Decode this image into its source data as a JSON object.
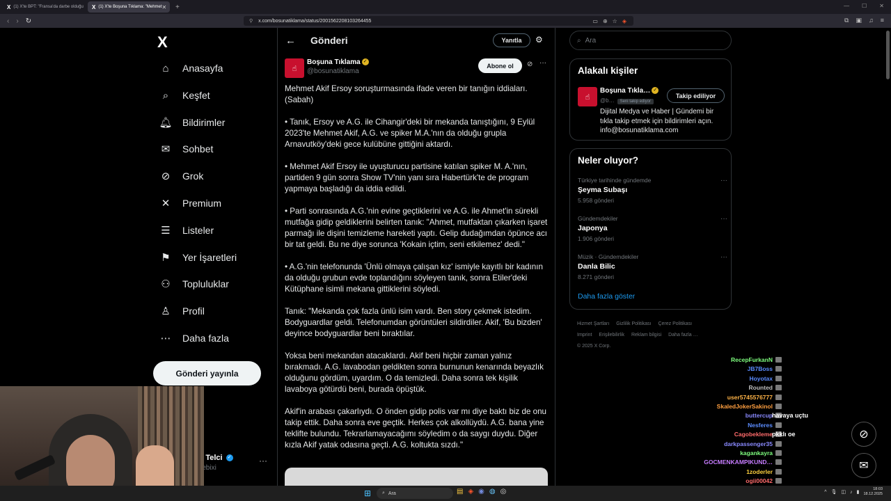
{
  "browser": {
    "tabs": [
      {
        "label": "(1) X'te BPT: \"Fransa'da darbe olduğu"
      },
      {
        "label": "(1) X'te Boşuna Tıklama: \"Mehmet"
      }
    ],
    "url": "x.com/bosunatiklama/status/2001562208103264455"
  },
  "nav": {
    "logo": "X",
    "items": [
      {
        "label": "Anasayfa",
        "icon": "home-icon",
        "glyph": "⌂"
      },
      {
        "label": "Keşfet",
        "icon": "search-icon",
        "glyph": "⌕"
      },
      {
        "label": "Bildirimler",
        "icon": "bell-icon",
        "glyph": "🔔︎",
        "badge": "1"
      },
      {
        "label": "Sohbet",
        "icon": "mail-icon",
        "glyph": "✉"
      },
      {
        "label": "Grok",
        "icon": "grok-icon",
        "glyph": "⊘"
      },
      {
        "label": "Premium",
        "icon": "x-premium-icon",
        "glyph": "✕"
      },
      {
        "label": "Listeler",
        "icon": "list-icon",
        "glyph": "☰"
      },
      {
        "label": "Yer İşaretleri",
        "icon": "bookmark-icon",
        "glyph": "⚑"
      },
      {
        "label": "Topluluklar",
        "icon": "communities-icon",
        "glyph": "⚇"
      },
      {
        "label": "Profil",
        "icon": "profile-icon",
        "glyph": "♙"
      },
      {
        "label": "Daha fazla",
        "icon": "more-circle-icon",
        "glyph": "⋯"
      }
    ],
    "post_button": "Gönderi yayınla",
    "profile_name": "r Telci",
    "profile_handle": "lebixi"
  },
  "post": {
    "header_title": "Gönderi",
    "reply_button": "Yanıtla",
    "author_name": "Boşuna Tıklama",
    "author_handle": "@bosunatiklama",
    "follow_button": "Abone ol",
    "paragraphs": [
      "Mehmet Akif Ersoy soruşturmasında ifade veren bir tanığın iddiaları. (Sabah)",
      "• Tanık, Ersoy ve A.G. ile Cihangir'deki bir mekanda tanıştığını, 9 Eylül 2023'te Mehmet Akif, A.G. ve spiker M.A.'nın da olduğu grupla Arnavutköy'deki gece kulübüne gittiğini aktardı.",
      "• Mehmet Akif Ersoy ile uyuşturucu partisine katılan spiker M. A.'nın, partiden 9 gün sonra Show TV'nin yanı sıra Habertürk'te de program yapmaya başladığı da iddia edildi.",
      "• Parti sonrasında A.G.'nin evine geçtiklerini ve A.G. ile Ahmet'in sürekli mutfağa gidip geldiklerini belirten tanık: \"Ahmet, mutfaktan çıkarken işaret parmağı ile dişini temizleme hareketi yaptı. Gelip dudağımdan öpünce acı bir tat geldi. Bu ne diye sorunca 'Kokain içtim, seni etkilemez' dedi.\"",
      "• A.G.'nin telefonunda 'Ünlü olmaya çalışan kız' ismiyle kayıtlı bir kadının da olduğu grubun evde toplandığını söyleyen tanık, sonra Etiler'deki Kütüphane isimli mekana gittiklerini söyledi.",
      "Tanık: \"Mekanda çok fazla ünlü isim vardı. Ben story çekmek istedim. Bodyguardlar geldi. Telefonumdan görüntüleri sildirdiler. Akif, 'Bu bizden' deyince bodyguardlar beni bıraktılar.",
      "Yoksa beni mekandan atacaklardı. Akif beni hiçbir zaman yalnız bırakmadı. A.G. lavabodan geldikten sonra burnunun kenarında beyazlık olduğunu gördüm, uyardım. O da temizledi. Daha sonra tek kişilik lavaboya götürdü beni, burada öpüştük.",
      "Akif'in arabası çakarlıydı. O önden gidip polis var mı diye baktı biz de onu takip ettik. Daha sonra eve geçtik. Herkes çok alkollüydü. A.G. bana yine teklifte bulundu. Tekrarlamayacağımı söyledim o da saygı duydu. Diğer kızla Akif yatak odasına geçti. A.G. koltukta sızdı.\""
    ]
  },
  "sidebar": {
    "search_placeholder": "Ara",
    "related_title": "Alakalı kişiler",
    "related": {
      "name": "Boşuna Tıkla…",
      "handle": "@b…",
      "sub_label": "Seni takip ediyor",
      "button": "Takip ediliyor",
      "bio": "Dijital Medya ve Haber | Gündemi bir tıkla takip etmek için bildirimleri açın. info@bosunatiklama.com"
    },
    "trends_title": "Neler oluyor?",
    "trends": [
      {
        "category": "Türkiye tarihinde gündemde",
        "name": "Şeyma Subaşı",
        "count": "5.958 gönderi"
      },
      {
        "category": "Gündemdekiler",
        "name": "Japonya",
        "count": "1.906 gönderi"
      },
      {
        "category": "Müzik · Gündemdekiler",
        "name": "Danla Bilic",
        "count": "8.271 gönderi"
      }
    ],
    "show_more": "Daha fazla göster",
    "footer": [
      "Hizmet Şartları",
      "Gizlilik Politikası",
      "Çerez Politikası",
      "Imprint",
      "Erişilebilirlik",
      "Reklam bilgisi",
      "Daha fazla …",
      "© 2025 X Corp."
    ]
  },
  "chat": [
    {
      "user": "RecepFurkanN",
      "color": "#7fff7f",
      "msg": ""
    },
    {
      "user": "JB7Boss",
      "color": "#5b8cff",
      "msg": ""
    },
    {
      "user": "Hoyotax",
      "color": "#5b8cff",
      "msg": ""
    },
    {
      "user": "Rounted",
      "color": "#bfbfbf",
      "msg": ""
    },
    {
      "user": "user5745576777",
      "color": "#ffb347",
      "msg": ""
    },
    {
      "user": "SkaledJokerSakinol",
      "color": "#ff9f40",
      "msg": ""
    },
    {
      "user": "buttercup",
      "color": "#8a8aff",
      "msg": "havaya uçtu"
    },
    {
      "user": "Nesferes",
      "color": "#5b8cff",
      "msg": ""
    },
    {
      "user": "Cagobekleme",
      "color": "#ff6b6b",
      "msg": "pkklı oe"
    },
    {
      "user": "darkpassenger35",
      "color": "#8a8aff",
      "msg": ""
    },
    {
      "user": "kagankayra",
      "color": "#7fff7f",
      "msg": ""
    },
    {
      "user": "GOCMENKAMPIKUND…",
      "color": "#c77dff",
      "msg": ""
    },
    {
      "user": "1zoderler",
      "color": "#ffd23f",
      "msg": ""
    },
    {
      "user": "ogii00042",
      "color": "#ff6b6b",
      "msg": ""
    },
    {
      "user": "JB7Boss",
      "color": "#5b8cff",
      "msg": ""
    }
  ],
  "taskbar": {
    "search": "Ara",
    "time": "18:03",
    "date": "18.12.2025"
  }
}
